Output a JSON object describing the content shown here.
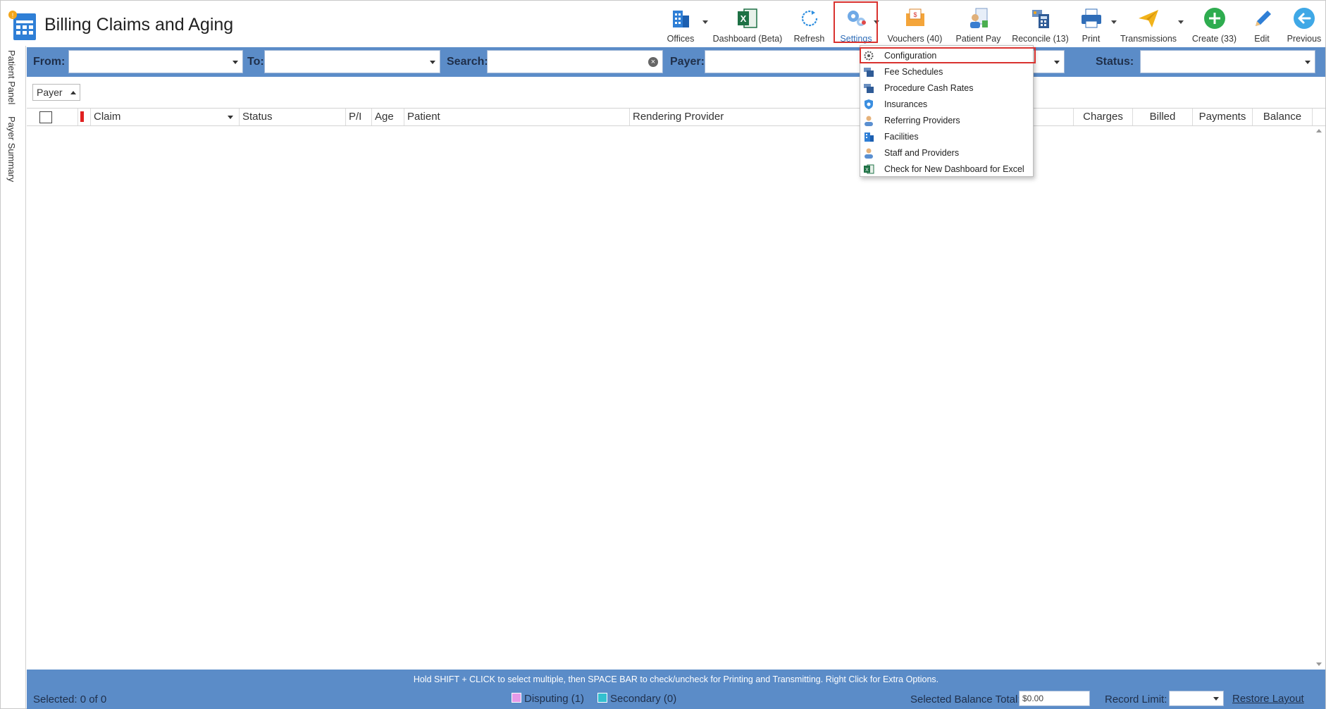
{
  "app": {
    "title": "Billing Claims and Aging"
  },
  "toolbar": {
    "offices": "Offices",
    "dashboard": "Dashboard (Beta)",
    "refresh": "Refresh",
    "settings": "Settings",
    "vouchers": "Vouchers (40)",
    "patient_pay": "Patient Pay",
    "reconcile": "Reconcile (13)",
    "print": "Print",
    "transmissions": "Transmissions",
    "create": "Create (33)",
    "edit": "Edit",
    "previous": "Previous"
  },
  "side_panel": {
    "tabs": [
      "Patient Panel",
      "Payer Summary"
    ]
  },
  "filters": {
    "from_label": "From:",
    "to_label": "To:",
    "search_label": "Search:",
    "payer_label": "Payer:",
    "status_label": "Status:",
    "from_value": "",
    "to_value": "",
    "search_value": "",
    "payer_value": "",
    "status_value": ""
  },
  "grouping": {
    "chip_label": "Payer"
  },
  "grid": {
    "columns": {
      "claim": "Claim",
      "status": "Status",
      "pi": "P/I",
      "age": "Age",
      "patient": "Patient",
      "rendering_provider": "Rendering Provider",
      "charges": "Charges",
      "billed": "Billed",
      "payments": "Payments",
      "balance": "Balance"
    },
    "rows": []
  },
  "settings_menu": {
    "items": [
      {
        "label": "Configuration",
        "icon": "gear-icon"
      },
      {
        "label": "Fee Schedules",
        "icon": "fee-schedule-icon"
      },
      {
        "label": "Procedure Cash Rates",
        "icon": "cash-rates-icon"
      },
      {
        "label": "Insurances",
        "icon": "shield-icon"
      },
      {
        "label": "Referring Providers",
        "icon": "person-icon"
      },
      {
        "label": "Facilities",
        "icon": "building-icon"
      },
      {
        "label": "Staff and Providers",
        "icon": "person-icon"
      },
      {
        "label": "Check for New Dashboard for Excel",
        "icon": "excel-icon"
      }
    ]
  },
  "footer": {
    "hint": "Hold SHIFT + CLICK to select multiple, then SPACE BAR to check/uncheck for Printing and Transmitting. Right Click for Extra Options.",
    "selected": "Selected: 0 of 0",
    "disputing": "Disputing (1)",
    "secondary": "Secondary (0)",
    "balance_label": "Selected Balance Total:",
    "balance_value": "$0.00",
    "record_limit_label": "Record Limit:",
    "record_limit_value": "",
    "restore_layout": "Restore Layout"
  },
  "colors": {
    "bar_blue": "#5b8cc8",
    "highlight_red": "#d9322f",
    "disputing": "#e59ae8",
    "secondary": "#33c0cf",
    "flag_red": "#e02020"
  }
}
